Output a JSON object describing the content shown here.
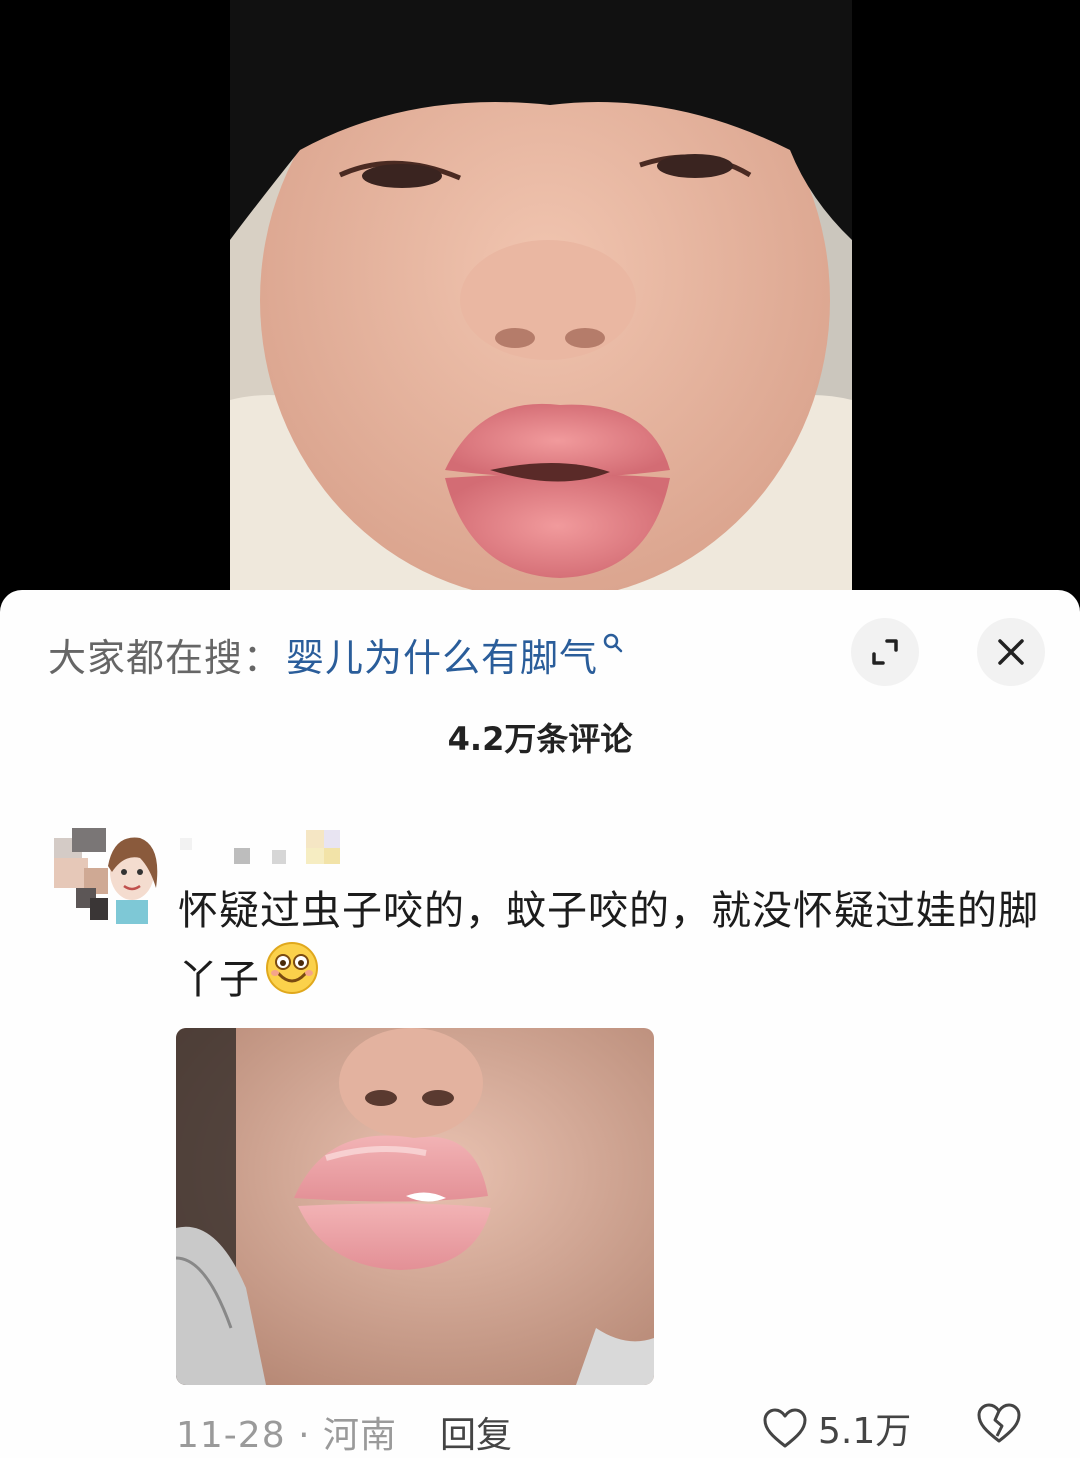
{
  "search": {
    "prefix": "大家都在搜：",
    "term": "婴儿为什么有脚气",
    "icon": "search-icon"
  },
  "header": {
    "comment_count": "4.2万条评论",
    "expand_icon": "expand-icon",
    "close_icon": "close-icon"
  },
  "comment": {
    "text": "怀疑过虫子咬的，蚊子咬的，就没怀疑过娃的脚丫子",
    "emoji": "smiley-emoji",
    "date": "11-28",
    "separator": "·",
    "location": "河南",
    "reply_label": "回复",
    "like_count": "5.1万"
  },
  "colors": {
    "search_link": "#2a5d9a",
    "sheet_bg": "#fefefe",
    "meta_gray": "#9a9a9a"
  }
}
